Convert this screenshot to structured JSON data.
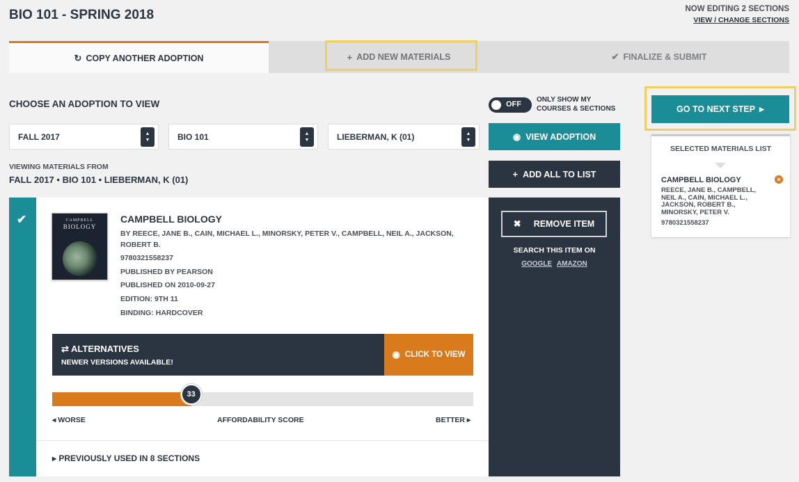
{
  "header": {
    "title": "BIO 101 - SPRING 2018",
    "editing_text": "NOW EDITING 2 SECTIONS",
    "view_change_link": "VIEW / CHANGE SECTIONS"
  },
  "tabs": [
    {
      "label": "COPY ANOTHER ADOPTION",
      "icon": "refresh-icon",
      "active": true
    },
    {
      "label": "ADD NEW MATERIALS",
      "icon": "plus-icon",
      "active": false
    },
    {
      "label": "FINALIZE & SUBMIT",
      "icon": "check-icon",
      "active": false
    }
  ],
  "chooser": {
    "label": "CHOOSE AN ADOPTION TO VIEW",
    "toggle_state": "OFF",
    "toggle_label_1": "ONLY SHOW MY",
    "toggle_label_2": "COURSES & SECTIONS",
    "term": "FALL 2017",
    "course": "BIO 101",
    "instructor": "LIEBERMAN, K (01)",
    "view_button": "VIEW ADOPTION",
    "add_all_button": "ADD ALL TO LIST",
    "viewing_from_label": "VIEWING MATERIALS FROM",
    "viewing_from_detail": "FALL 2017 • BIO 101 • LIEBERMAN, K (01)"
  },
  "material": {
    "title": "CAMPBELL BIOLOGY",
    "authors": "BY REECE, JANE B., CAIN, MICHAEL L., MINORSKY, PETER V., CAMPBELL, NEIL A., JACKSON, ROBERT B.",
    "isbn": "9780321558237",
    "publisher": "PUBLISHED BY PEARSON",
    "published_on": "PUBLISHED ON 2010-09-27",
    "edition": "EDITION: 9TH 11",
    "binding": "BINDING: HARDCOVER",
    "cover_top": "CAMPBELL",
    "cover_title": "BIOLOGY",
    "alternatives_title": "ALTERNATIVES",
    "alternatives_sub": "NEWER VERSIONS AVAILABLE!",
    "click_to_view": "CLICK TO VIEW",
    "affordability_score": 33,
    "affordability_fraction": 0.33,
    "worse_label": "WORSE",
    "score_label": "AFFORDABILITY SCORE",
    "better_label": "BETTER",
    "previously_used": "PREVIOUSLY USED IN 8 SECTIONS",
    "remove_button": "REMOVE ITEM",
    "search_label": "SEARCH THIS ITEM ON",
    "search_google": "GOOGLE",
    "search_amazon": "AMAZON"
  },
  "sidebar": {
    "next_step_button": "GO TO NEXT STEP",
    "selected_list_title": "SELECTED MATERIALS LIST",
    "item_title": "CAMPBELL BIOLOGY",
    "item_authors": "REECE, JANE B., CAMPBELL, NEIL A., CAIN, MICHAEL L., JACKSON, ROBERT B., MINORSKY, PETER V.",
    "item_isbn": "9780321558237"
  },
  "colors": {
    "teal": "#1b8d96",
    "navy": "#2b3441",
    "orange": "#d97b1c",
    "highlight": "#f1cf5e"
  }
}
